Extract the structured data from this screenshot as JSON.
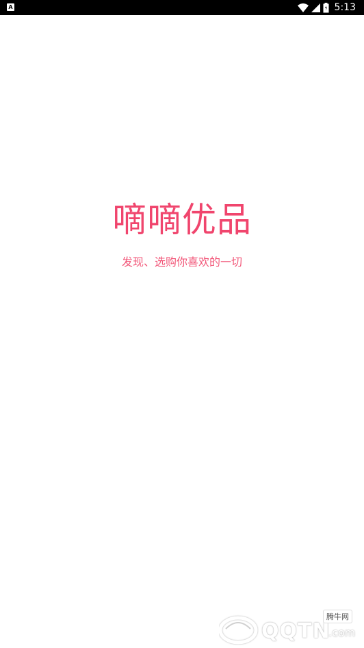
{
  "status_bar": {
    "notification_icon": "A",
    "time": "5:13",
    "icons": [
      "wifi-icon",
      "signal-icon",
      "battery-icon"
    ]
  },
  "splash": {
    "app_name": "嘀嘀优品",
    "slogan": "发现、选购你喜欢的一切"
  },
  "watermark": {
    "brand": "QQTN",
    "domain": ".com",
    "badge": "腾牛网"
  },
  "colors": {
    "accent": "#f0456d",
    "status_bar_bg": "#000000",
    "background": "#ffffff"
  }
}
